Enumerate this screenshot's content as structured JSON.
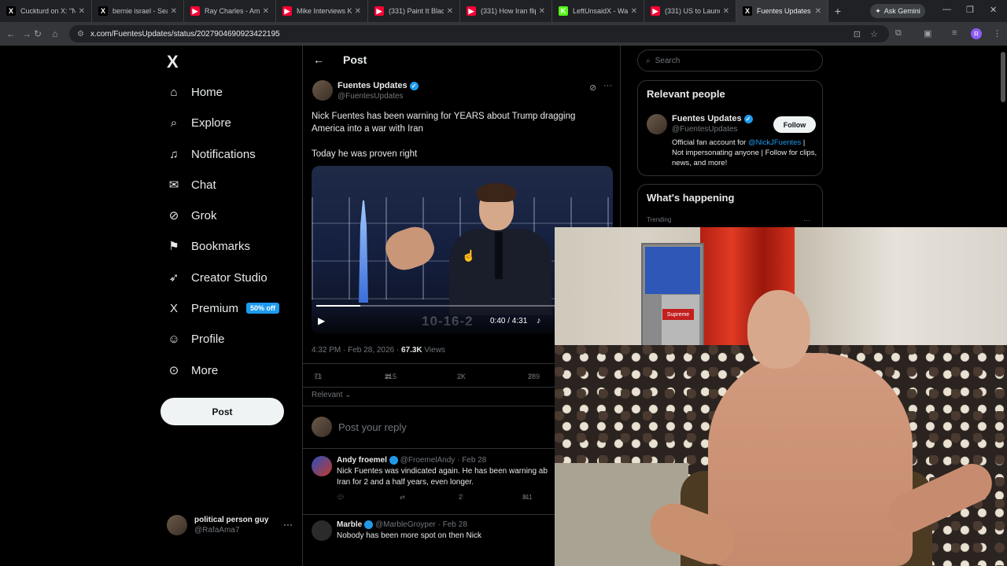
{
  "browser": {
    "tabs": [
      {
        "title": "Cuckturd on X: \"Ni",
        "fav": "X",
        "color": "#000000"
      },
      {
        "title": "bernie israel - Sear",
        "fav": "X",
        "color": "#000000"
      },
      {
        "title": "Ray Charles - Amer",
        "fav": "▶",
        "color": "#ff0033"
      },
      {
        "title": "Mike Interviews Ka",
        "fav": "▶",
        "color": "#ff0033"
      },
      {
        "title": "(331) Paint It Black",
        "fav": "▶",
        "color": "#ff0033"
      },
      {
        "title": "(331) How Iran flip",
        "fav": "▶",
        "color": "#ff0033"
      },
      {
        "title": "LeftUnsaidX - Watc",
        "fav": "K",
        "color": "#53fc18"
      },
      {
        "title": "(331) US to Launch",
        "fav": "▶",
        "color": "#ff0033"
      },
      {
        "title": "Fuentes Updates o",
        "fav": "X",
        "color": "#000000",
        "active": true
      }
    ],
    "new_tab": "+",
    "gemini_label": "Ask Gemini",
    "url": "x.com/FuentesUpdates/status/2027904690923422195",
    "profile_letter": "R"
  },
  "sidebar": {
    "logo": "X",
    "items": [
      {
        "label": "Home",
        "icon": "home-icon",
        "glyph": "⌂"
      },
      {
        "label": "Explore",
        "icon": "search-icon",
        "glyph": "⌕"
      },
      {
        "label": "Notifications",
        "icon": "bell-icon",
        "glyph": "♫"
      },
      {
        "label": "Chat",
        "icon": "mail-icon",
        "glyph": "✉"
      },
      {
        "label": "Grok",
        "icon": "grok-icon",
        "glyph": "⊘"
      },
      {
        "label": "Bookmarks",
        "icon": "bookmark-icon",
        "glyph": "⚑"
      },
      {
        "label": "Creator Studio",
        "icon": "rocket-icon",
        "glyph": "➶"
      },
      {
        "label": "Premium",
        "icon": "x-premium-icon",
        "glyph": "X",
        "badge": "50% off"
      },
      {
        "label": "Profile",
        "icon": "person-icon",
        "glyph": "☺"
      },
      {
        "label": "More",
        "icon": "more-circle-icon",
        "glyph": "⊙"
      }
    ],
    "post_button": "Post",
    "account": {
      "name": "political person guy",
      "handle": "@RafaAma7",
      "menu": "···"
    }
  },
  "main": {
    "header_title": "Post",
    "tweet": {
      "name": "Fuentes Updates",
      "handle": "@FuentesUpdates",
      "text1": "Nick Fuentes has been warning for YEARS about Trump dragging America into a war with Iran",
      "text2": "Today he was proven right",
      "video": {
        "time": "0:40 / 4:31",
        "desk_text": "10-16-2",
        "progress": 0.15
      },
      "timestamp": "4:32 PM · Feb 28, 2026 · ",
      "views_count": "67.3K",
      "views_label": " Views",
      "replies": "71",
      "reposts": "215",
      "likes": "2K",
      "bookmarks": "289"
    },
    "sort_label": "Relevant",
    "reply_placeholder": "Post your reply",
    "replies": [
      {
        "name": "Andy froemel",
        "handle": "@FroemelAndy · Feb 28",
        "text": "Nick Fuentes was vindicated again. He has been warning ab",
        "text2": "Iran for 2 and a half years, even longer.",
        "likes": "2",
        "views": "311"
      },
      {
        "name": "Marble",
        "handle": "@MarbleGroyper · Feb 28",
        "text": "Nobody has been more spot on then Nick"
      }
    ]
  },
  "right": {
    "search_placeholder": "Search",
    "relevant_title": "Relevant people",
    "person": {
      "name": "Fuentes Updates",
      "handle": "@FuentesUpdates",
      "follow": "Follow",
      "bio_a": "Official fan account for ",
      "bio_link": "@NickJFuentes",
      "bio_b": " | Not impersonating anyone | Follow for clips, news, and more!"
    },
    "whats_happening": "What's happening",
    "trending": "Trending",
    "trend_more": "···"
  },
  "webcam": {
    "shelf_label": "Supreme"
  }
}
